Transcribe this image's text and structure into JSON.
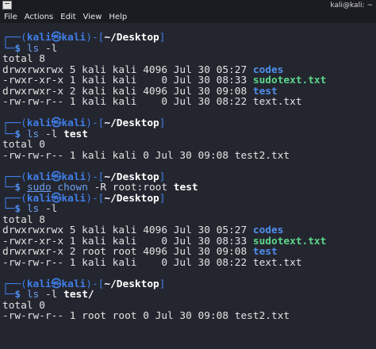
{
  "titlebar": {
    "title": "kali@kali: ~"
  },
  "menu": [
    "File",
    "Actions",
    "Edit",
    "View",
    "Help"
  ],
  "prompt": {
    "user": "kali",
    "at_symbol": "㉿",
    "host": "kali",
    "path": "~/Desktop"
  },
  "blocks": [
    {
      "command": "ls -l",
      "cmd_parts": [
        {
          "text": "ls -l",
          "style": "cmd"
        }
      ],
      "output": [
        {
          "text": "total 8"
        },
        {
          "text": "drwxrwxrwx 5 kali kali 4096 Jul 30 05:27 ",
          "name": "codes",
          "name_style": "blue"
        },
        {
          "text": "-rwxr-xr-x 1 kali kali    0 Jul 30 08:33 ",
          "name": "sudotext.txt",
          "name_style": "green"
        },
        {
          "text": "drwxrwxr-x 2 kali kali 4096 Jul 30 09:08 ",
          "name": "test",
          "name_style": "blue"
        },
        {
          "text": "-rw-rw-r-- 1 kali kali    0 Jul 30 08:22 ",
          "name": "text.txt",
          "name_style": "plain"
        }
      ]
    },
    {
      "command": "ls -l test",
      "output": [
        {
          "text": "total 0"
        },
        {
          "text": "-rw-rw-r-- 1 kali kali 0 Jul 30 09:08 test2.txt"
        }
      ]
    },
    {
      "command": "sudo chown -R root:root test",
      "output": []
    },
    {
      "command": "ls -l",
      "output": [
        {
          "text": "total 8"
        },
        {
          "text": "drwxrwxrwx 5 kali kali 4096 Jul 30 05:27 ",
          "name": "codes",
          "name_style": "blue"
        },
        {
          "text": "-rwxr-xr-x 1 kali kali    0 Jul 30 08:33 ",
          "name": "sudotext.txt",
          "name_style": "green"
        },
        {
          "text": "drwxrwxr-x 2 root root 4096 Jul 30 09:08 ",
          "name": "test",
          "name_style": "blue"
        },
        {
          "text": "-rw-rw-r-- 1 kali kali    0 Jul 30 08:22 ",
          "name": "text.txt",
          "name_style": "plain"
        }
      ]
    },
    {
      "command": "ls -l test/",
      "output": [
        {
          "text": "total 0"
        },
        {
          "text": "-rw-rw-r-- 1 root root 0 Jul 30 09:08 test2.txt"
        }
      ]
    }
  ],
  "colors": {
    "background": "#24262f",
    "prompt": "#3f7ee8",
    "directory": "#4f8ff0",
    "executable": "#5cd68a",
    "text": "#e2e2e2"
  }
}
